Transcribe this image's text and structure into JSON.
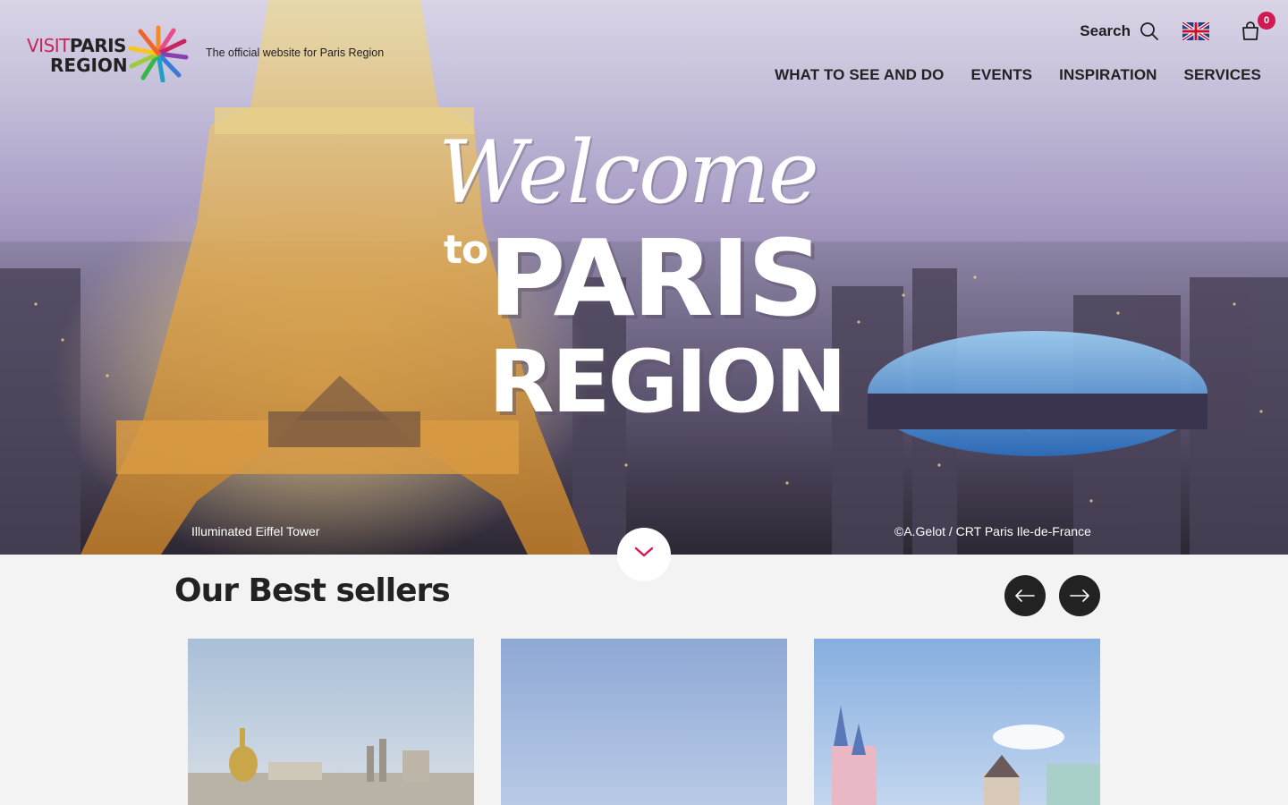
{
  "header": {
    "logo": {
      "visit": "VISIT",
      "paris": "PARIS",
      "region": "REGION"
    },
    "tagline": "The official website for Paris Region",
    "search_label": "Search",
    "cart_count": "0",
    "language_icon": "uk-flag-icon",
    "nav": [
      {
        "label": "WHAT TO SEE AND DO"
      },
      {
        "label": "EVENTS"
      },
      {
        "label": "INSPIRATION"
      },
      {
        "label": "SERVICES"
      }
    ]
  },
  "hero": {
    "title_script": "Welcome",
    "title_to": "to",
    "title_paris": "PARIS",
    "title_region": "REGION",
    "caption": "Illuminated Eiffel Tower",
    "credit": "©A.Gelot / CRT Paris Ile-de-France"
  },
  "best_sellers": {
    "title": "Our Best sellers"
  },
  "colors": {
    "accent": "#d11a52",
    "dark": "#222222",
    "background": "#f3f3f3"
  }
}
